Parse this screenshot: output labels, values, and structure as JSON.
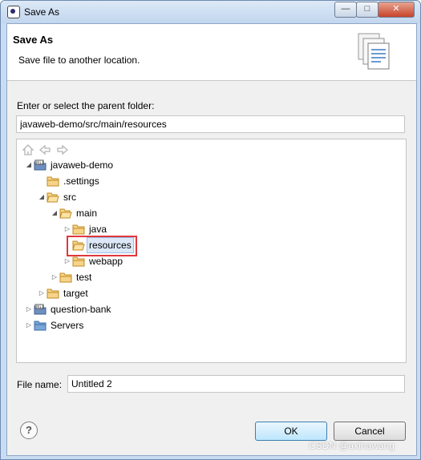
{
  "window": {
    "title": "Save As",
    "minimize_glyph": "—",
    "maximize_glyph": "□",
    "close_glyph": "✕"
  },
  "header": {
    "title": "Save As",
    "subtitle": "Save file to another location.",
    "icon": "document-save-icon"
  },
  "parent_folder": {
    "label": "Enter or select the parent folder:",
    "value": "javaweb-demo/src/main/resources"
  },
  "tree_toolbar": {
    "home_icon": "home-icon",
    "back_icon": "back-arrow-icon",
    "forward_icon": "forward-arrow-icon"
  },
  "tree": [
    {
      "label": "javaweb-demo",
      "expanded": true,
      "type": "maven-project"
    },
    {
      "label": ".settings",
      "type": "folder"
    },
    {
      "label": "src",
      "expanded": true,
      "type": "folder"
    },
    {
      "label": "main",
      "expanded": true,
      "type": "folder"
    },
    {
      "label": "java",
      "expanded": false,
      "type": "folder"
    },
    {
      "label": "resources",
      "selected": true,
      "type": "folder"
    },
    {
      "label": "webapp",
      "expanded": false,
      "type": "folder"
    },
    {
      "label": "test",
      "expanded": false,
      "type": "folder"
    },
    {
      "label": "target",
      "expanded": false,
      "type": "folder"
    },
    {
      "label": "question-bank",
      "expanded": false,
      "type": "maven-project"
    },
    {
      "label": "Servers",
      "expanded": false,
      "type": "project-folder"
    }
  ],
  "file_name": {
    "label": "File name:",
    "value": "Untitled 2"
  },
  "buttons": {
    "help": "?",
    "ok": "OK",
    "cancel": "Cancel"
  },
  "watermark": "CSDN @axinawang",
  "colors": {
    "selection_border": "#e0383e",
    "folder": "#e8b24a",
    "selection_fill": "#dce8f7"
  }
}
